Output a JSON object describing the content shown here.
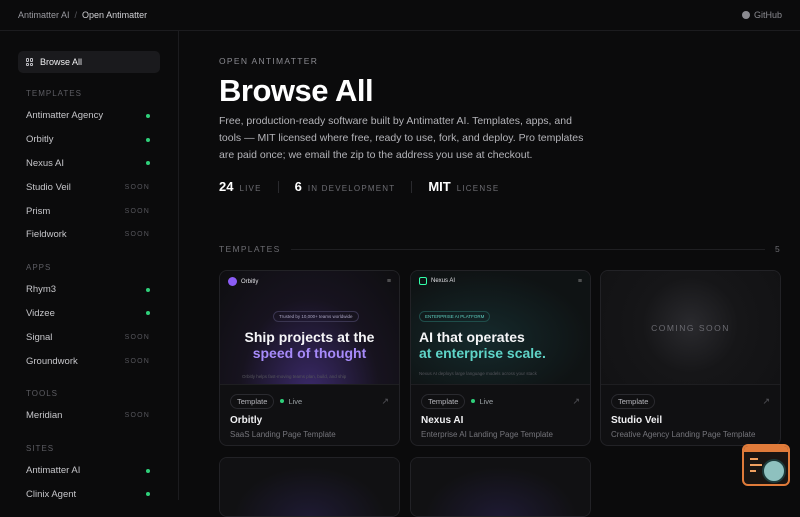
{
  "topbar": {
    "crumbs": [
      "Antimatter AI",
      "Open Antimatter"
    ],
    "separator": "/",
    "github_label": "GitHub"
  },
  "sidebar": {
    "browse_label": "Browse All",
    "sections": [
      {
        "title": "TEMPLATES",
        "items": [
          {
            "label": "Antimatter Agency",
            "status": "live"
          },
          {
            "label": "Orbitly",
            "status": "live"
          },
          {
            "label": "Nexus AI",
            "status": "live"
          },
          {
            "label": "Studio Veil",
            "status": "SOON"
          },
          {
            "label": "Prism",
            "status": "SOON"
          },
          {
            "label": "Fieldwork",
            "status": "SOON"
          }
        ]
      },
      {
        "title": "APPS",
        "items": [
          {
            "label": "Rhym3",
            "status": "live"
          },
          {
            "label": "Vidzee",
            "status": "live"
          },
          {
            "label": "Signal",
            "status": "SOON"
          },
          {
            "label": "Groundwork",
            "status": "SOON"
          }
        ]
      },
      {
        "title": "TOOLS",
        "items": [
          {
            "label": "Meridian",
            "status": "SOON"
          }
        ]
      },
      {
        "title": "SITES",
        "items": [
          {
            "label": "Antimatter AI",
            "status": "live"
          },
          {
            "label": "Clinix Agent",
            "status": "live"
          }
        ]
      }
    ]
  },
  "main": {
    "eyebrow": "OPEN ANTIMATTER",
    "title": "Browse All",
    "description": "Free, production-ready software built by Antimatter AI. Templates, apps, and tools — MIT licensed where free, ready to use, fork, and deploy. Pro templates are paid once; we email the zip to the address you use at checkout.",
    "stats": [
      {
        "value": "24",
        "label": "LIVE"
      },
      {
        "value": "6",
        "label": "IN DEVELOPMENT"
      },
      {
        "value": "MIT",
        "label": "LICENSE"
      }
    ],
    "section": {
      "title": "TEMPLATES",
      "count": "5"
    },
    "cards": [
      {
        "tag": "Template",
        "live": "Live",
        "title": "Orbitly",
        "subtitle": "SaaS Landing Page Template",
        "thumb": {
          "brand": "Orbitly",
          "pill": "Trusted by 10,000+ teams worldwide",
          "hero1": "Ship projects at the",
          "hero2": "speed of thought",
          "faint": "Orbitly helps fast-moving teams plan, build, and ship"
        }
      },
      {
        "tag": "Template",
        "live": "Live",
        "title": "Nexus AI",
        "subtitle": "Enterprise AI Landing Page Template",
        "thumb": {
          "brand": "Nexus AI",
          "pill": "ENTERPRISE AI PLATFORM",
          "hero1": "AI that operates",
          "hero2": "at enterprise scale.",
          "faint": "Nexus AI deploys large language models across your stack"
        }
      },
      {
        "tag": "Template",
        "live": "",
        "title": "Studio Veil",
        "subtitle": "Creative Agency Landing Page Template",
        "thumb": {
          "coming": "COMING SOON"
        }
      }
    ]
  },
  "colors": {
    "accent_live": "#2fd07a",
    "orbitly_accent": "#a78bfa",
    "nexus_accent": "#5fd4c8"
  }
}
